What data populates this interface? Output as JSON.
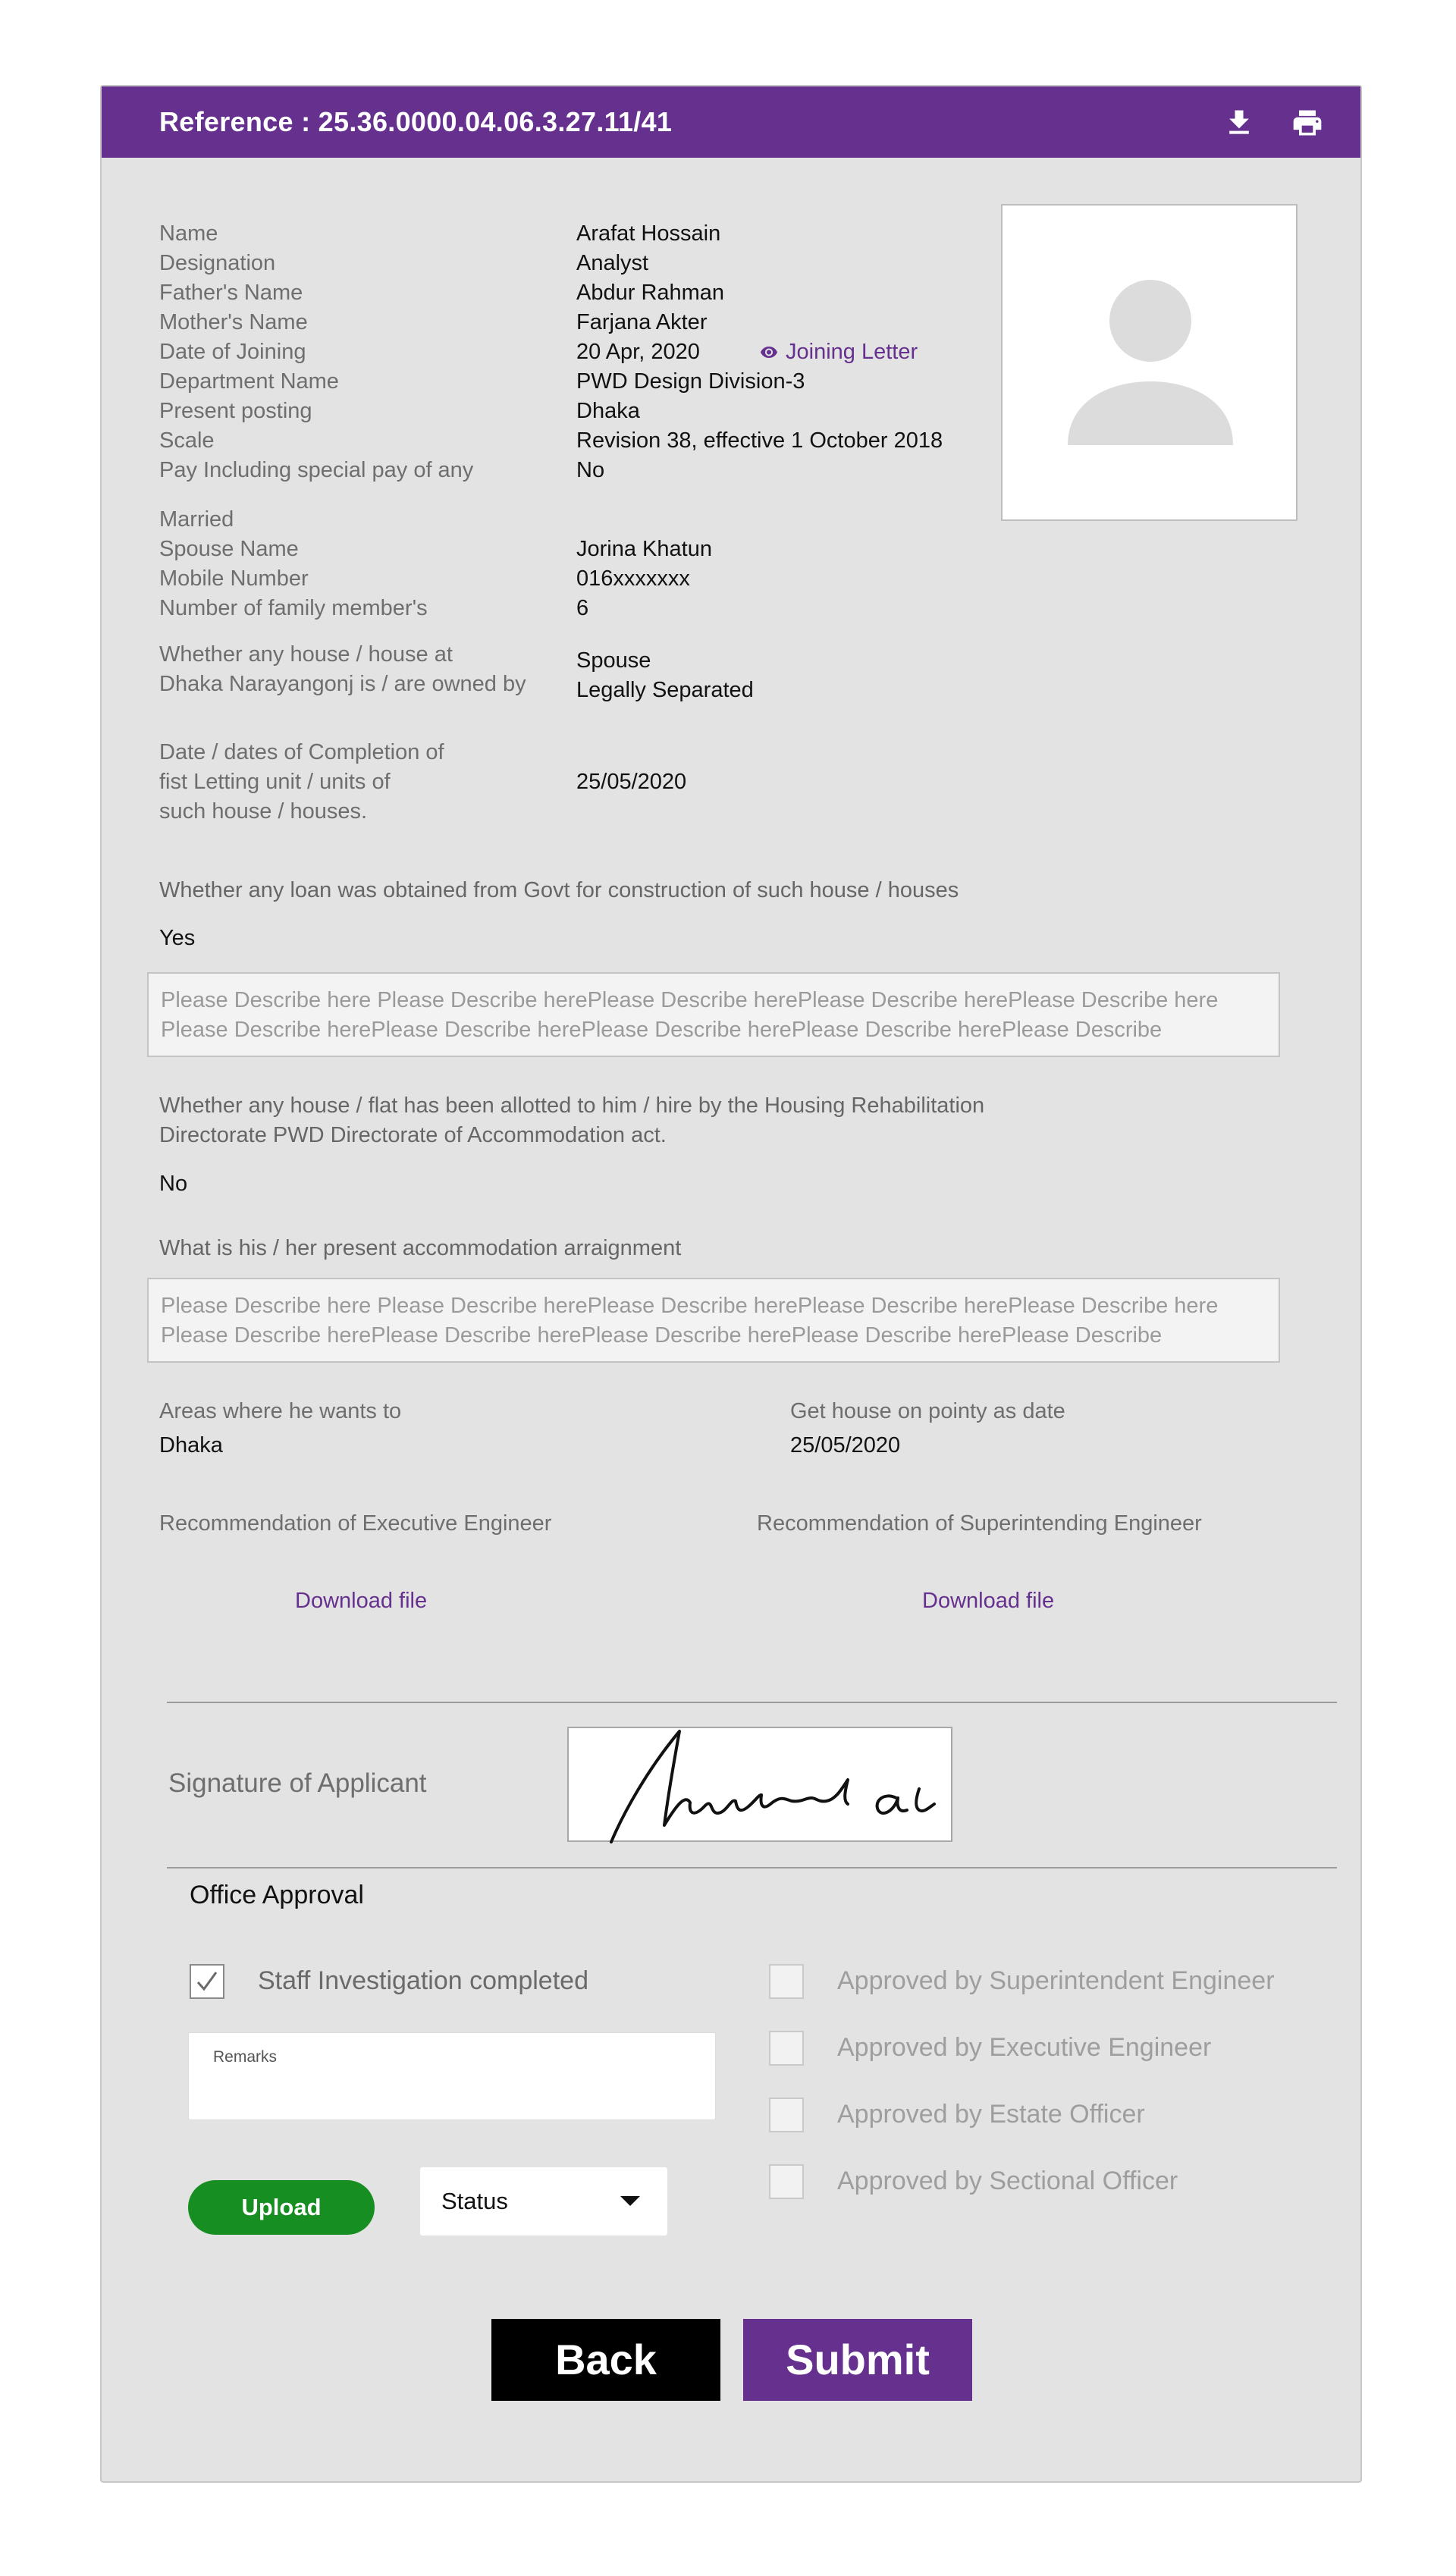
{
  "header": {
    "reference": "Reference : 25.36.0000.04.06.3.27.11/41",
    "download_icon": "download-icon",
    "print_icon": "print-icon"
  },
  "profile": {
    "fields": [
      {
        "label": "Name",
        "value": "Arafat Hossain"
      },
      {
        "label": "Designation",
        "value": "Analyst"
      },
      {
        "label": "Father's Name",
        "value": "Abdur Rahman"
      },
      {
        "label": "Mother's Name",
        "value": "Farjana Akter"
      },
      {
        "label": "Date of Joining",
        "value": "20 Apr, 2020"
      },
      {
        "label": "Department Name",
        "value": "PWD Design Division-3"
      },
      {
        "label": "Present posting",
        "value": "Dhaka"
      },
      {
        "label": "Scale",
        "value": "Revision 38, effective 1 October 2018"
      },
      {
        "label": "Pay Including special pay of any",
        "value": "No"
      }
    ],
    "joining_letter_link": "Joining Letter",
    "married_label": "Married",
    "family": [
      {
        "label": "Spouse Name",
        "value": "Jorina Khatun"
      },
      {
        "label": "Mobile Number",
        "value": "016xxxxxxx"
      },
      {
        "label": "Number of family member's",
        "value": "6"
      }
    ],
    "house_owned": {
      "label_line1": "Whether any house /  house at",
      "label_line2": "Dhaka Narayangonj is / are owned by",
      "value_line1": "Spouse",
      "value_line2": "Legally Separated"
    },
    "completion": {
      "label_line1": "Date / dates of Completion of",
      "label_line2": "fist Letting unit / units of",
      "label_line3": "such house / houses.",
      "value": "25/05/2020"
    },
    "avatar_icon": "user-avatar-icon"
  },
  "loan": {
    "question": "Whether any loan was obtained from Govt for construction of such house / houses",
    "answer": "Yes",
    "description": "Please Describe here Please Describe herePlease Describe herePlease Describe herePlease Describe here Please Describe herePlease Describe herePlease Describe herePlease Describe herePlease Describe"
  },
  "allotted": {
    "question_line1": "Whether any house / flat has been allotted to him / hire by the Housing Rehabilitation",
    "question_line2": "Directorate PWD Directorate of Accommodation act.",
    "answer": "No"
  },
  "accommodation": {
    "question": "What is his / her present accommodation arraignment",
    "description": "Please Describe here Please Describe herePlease Describe herePlease Describe herePlease Describe here Please Describe herePlease Describe herePlease Describe herePlease Describe herePlease Describe"
  },
  "areas": {
    "label": "Areas where he wants to",
    "value": "Dhaka"
  },
  "priority_date": {
    "label": "Get house on pointy as date",
    "value": "25/05/2020"
  },
  "recommendations": {
    "executive_label": "Recommendation of Executive Engineer",
    "superintending_label": "Recommendation of Superintending Engineer",
    "download_executive": "Download file",
    "download_superintending": "Download file"
  },
  "signature": {
    "label": "Signature of Applicant"
  },
  "office_approval": {
    "title": "Office Approval",
    "staff_investigation": {
      "label": "Staff Investigation completed",
      "checked": true
    },
    "approvals": [
      {
        "label": "Approved by Superintendent Engineer",
        "checked": false
      },
      {
        "label": "Approved by Executive Engineer",
        "checked": false
      },
      {
        "label": "Approved by Estate Officer",
        "checked": false
      },
      {
        "label": "Approved by Sectional Officer",
        "checked": false
      }
    ],
    "remarks_placeholder": "Remarks",
    "upload_label": "Upload",
    "status_label": "Status"
  },
  "actions": {
    "back_label": "Back",
    "submit_label": "Submit"
  },
  "colors": {
    "brand": "#66308f",
    "upload": "#178e22",
    "card": "#e3e3e3"
  }
}
